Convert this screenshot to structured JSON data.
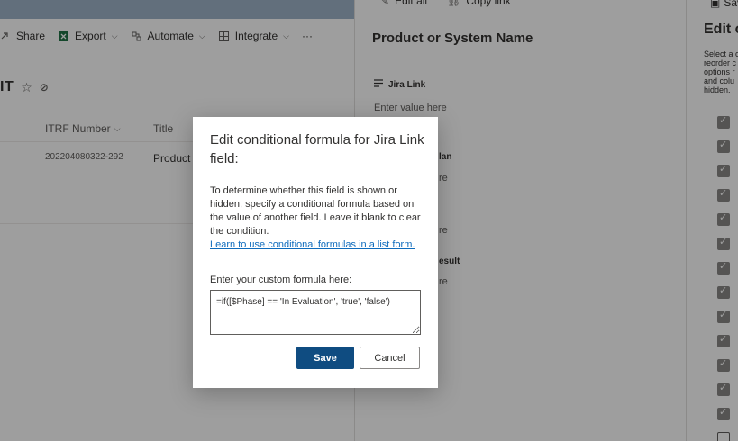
{
  "list_page": {
    "command_bar": {
      "share": "Share",
      "export": "Export",
      "automate": "Automate",
      "integrate": "Integrate",
      "more": "···"
    },
    "title_fragment": "IT",
    "columns": [
      "ITRF Number",
      "Title"
    ],
    "rows": [
      {
        "itrf_number": "202204080322-292",
        "title": "Product o"
      }
    ]
  },
  "form_panel": {
    "command_bar": {
      "edit_all": "Edit all",
      "copy_link": "Copy link"
    },
    "title": "Product or System Name",
    "fields": [
      {
        "label": "Jira Link",
        "placeholder": "Enter value here"
      }
    ],
    "partial_labels": [
      "lan",
      "esult"
    ],
    "partial_placeholders": [
      "re",
      "re",
      "re"
    ]
  },
  "right_pane": {
    "save_label": "Sav",
    "title": "Edit c",
    "description": "Select a c\nreorder c\noptions r\nand colu\nhidden."
  },
  "dialog": {
    "title": "Edit conditional formula for Jira Link field:",
    "body": "To determine whether this field is shown or hidden, specify a conditional formula based on the value of another field. Leave it blank to clear the condition.",
    "link": "Learn to use conditional formulas in a list form.",
    "input_label": "Enter your custom formula here:",
    "formula": "=if([$Phase] == 'In Evaluation', 'true', 'false')",
    "save_label": "Save",
    "cancel_label": "Cancel"
  }
}
